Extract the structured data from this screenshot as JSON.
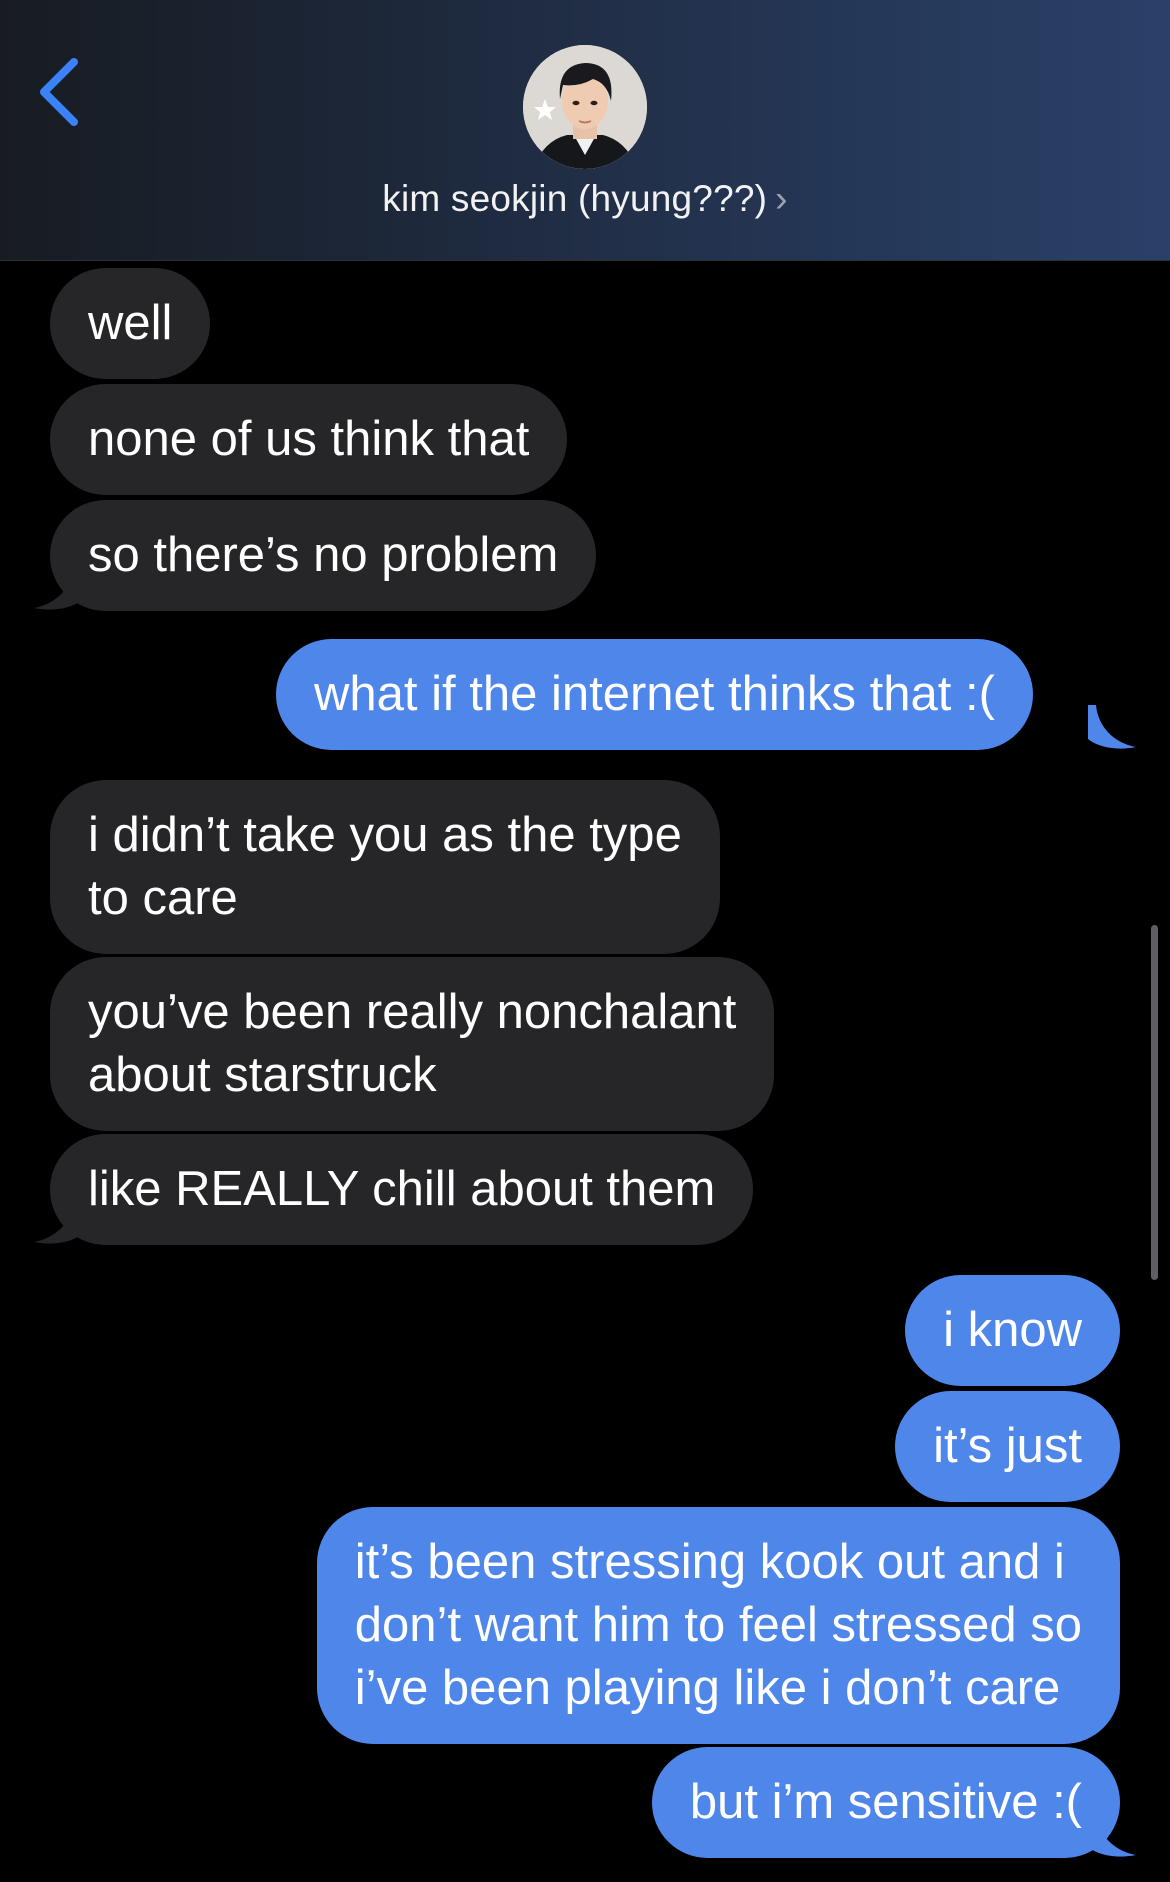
{
  "header": {
    "contact_name": "kim seokjin (hyung???)",
    "chevron": "›",
    "back_icon": "chevron-left-icon",
    "accent_color": "#3b82f6"
  },
  "messages": [
    {
      "direction": "received",
      "text": "well"
    },
    {
      "direction": "received",
      "text": "none of us think that"
    },
    {
      "direction": "received",
      "text": "so there’s no problem"
    },
    {
      "direction": "sent",
      "text": "what if the internet thinks that :("
    },
    {
      "direction": "received",
      "text": "i didn’t take you as the type\nto care"
    },
    {
      "direction": "received",
      "text": "you’ve been really nonchalant\nabout starstruck"
    },
    {
      "direction": "received",
      "text": "like REALLY chill about them"
    },
    {
      "direction": "sent",
      "text": "i know"
    },
    {
      "direction": "sent",
      "text": "it’s just"
    },
    {
      "direction": "sent",
      "text": "it’s been stressing kook out and i\ndon’t want him to feel stressed so\ni’ve been playing like i don’t care"
    },
    {
      "direction": "sent",
      "text": "but i’m sensitive :("
    }
  ],
  "colors": {
    "sent_bubble": "#4f86e9",
    "received_bubble": "#262628",
    "background": "#000000"
  }
}
